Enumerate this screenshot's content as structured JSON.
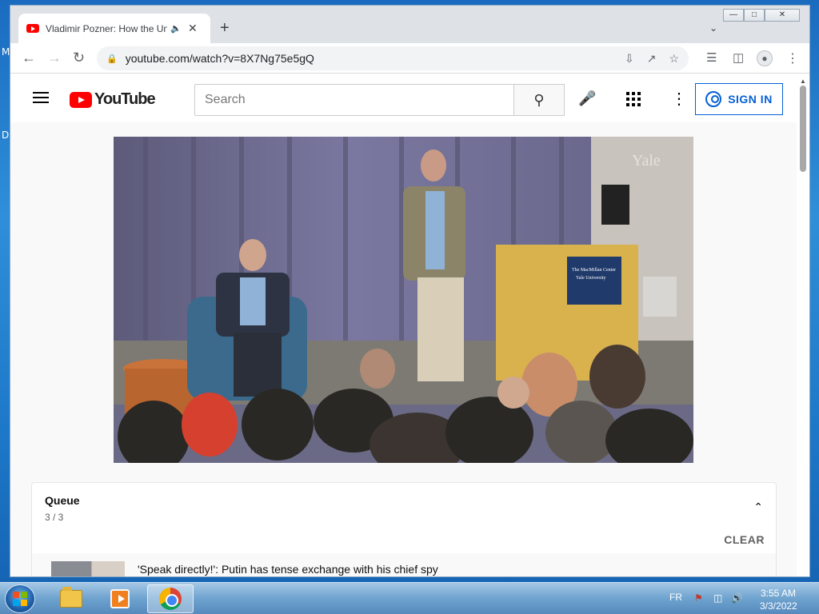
{
  "desktop": {
    "letters": [
      "M",
      "D"
    ]
  },
  "browser": {
    "tab": {
      "title": "Vladimir Pozner: How the United States Created Vladimir Putin",
      "audio_icon": "speaker-icon"
    },
    "url": "youtube.com/watch?v=8X7Ng75e5gQ"
  },
  "youtube": {
    "logo_text": "YouTube",
    "search_placeholder": "Search",
    "sign_in_label": "SIGN IN"
  },
  "video": {
    "stage_signs": [
      "Yale",
      "The MacMillan Center",
      "Yale University"
    ]
  },
  "queue": {
    "title": "Queue",
    "count": "3 / 3",
    "clear_label": "CLEAR",
    "items": [
      {
        "title": "'Speak directly!': Putin has tense exchange with his chief spy"
      }
    ]
  },
  "taskbar": {
    "language": "FR",
    "time": "3:55 AM",
    "date": "3/3/2022",
    "apps": [
      "file-explorer",
      "media-player",
      "chrome"
    ]
  }
}
